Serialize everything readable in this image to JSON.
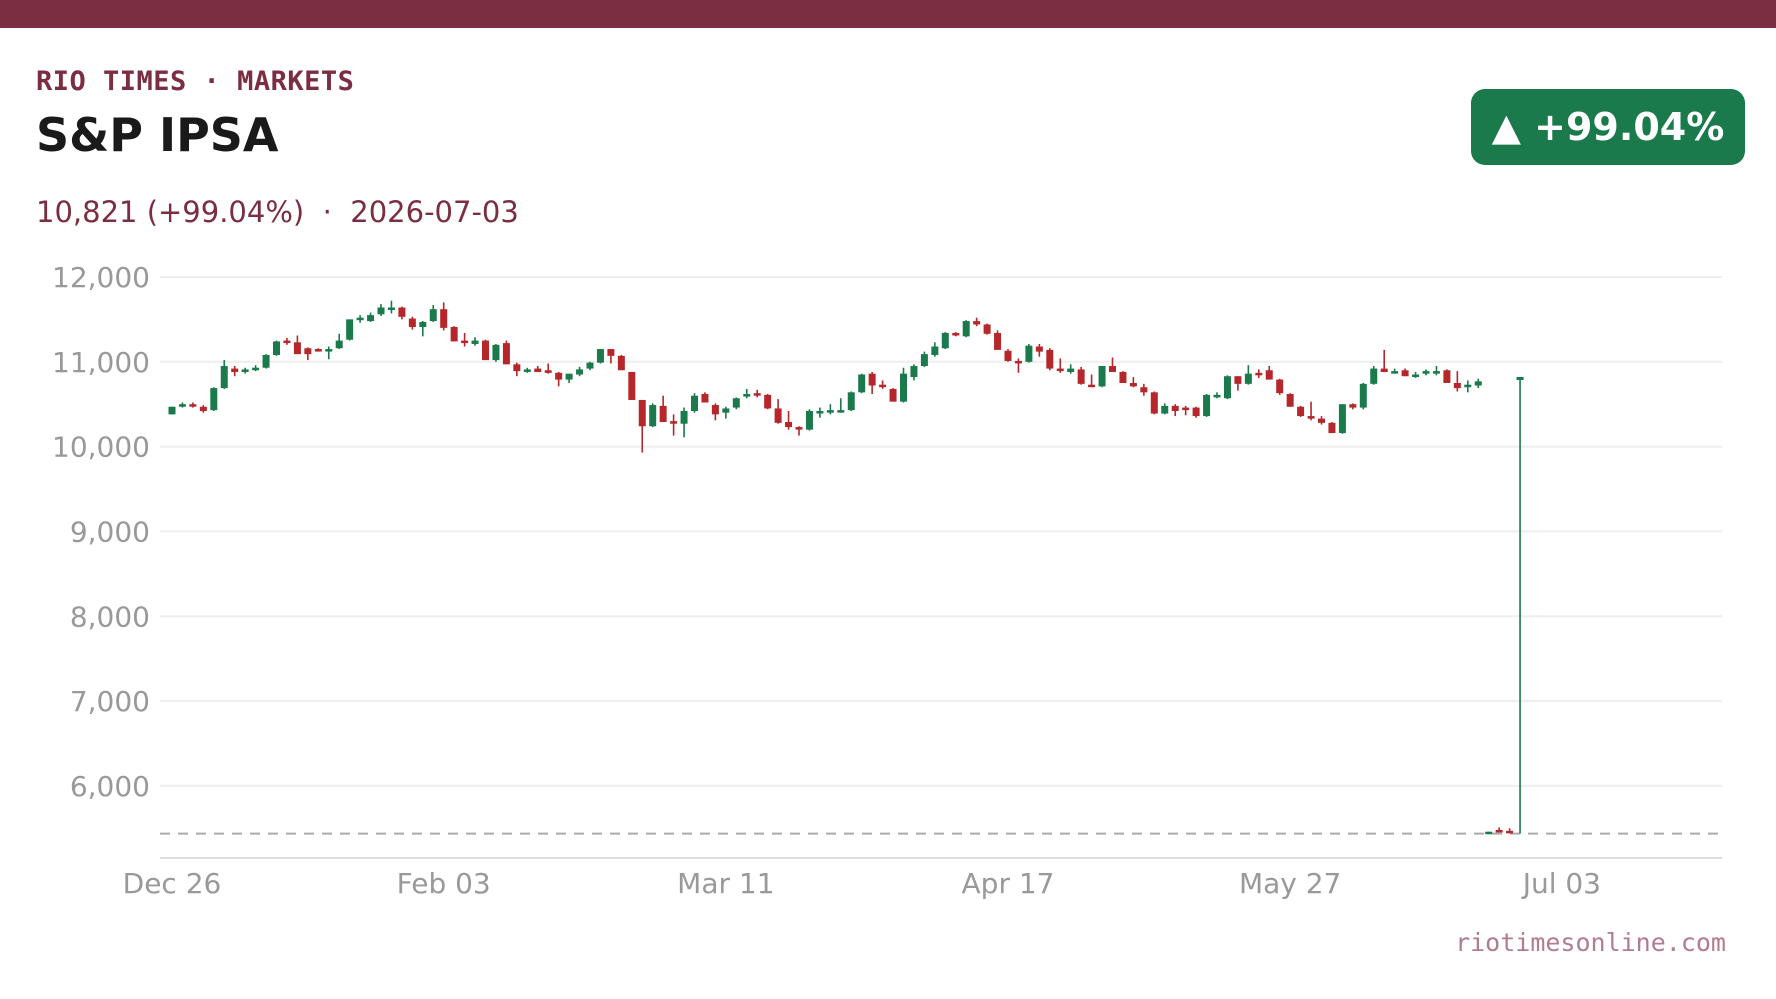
{
  "header": {
    "brand": "RIO TIMES · MARKETS",
    "title": "S&P IPSA",
    "subtitle": "10,821 (+99.04%)  ·  2026-07-03",
    "badge": "▲ +99.04%",
    "source": "riotimesonline.com"
  },
  "colors": {
    "accent": "#7b2d41",
    "up": "#1a7a4c",
    "down": "#b5272a",
    "grid": "#eeeeee",
    "axis_text": "#999999"
  },
  "chart_data": {
    "type": "candlestick",
    "title": "",
    "xlabel": "",
    "ylabel": "",
    "ylim": [
      5150,
      12200
    ],
    "yticks": [
      6000,
      7000,
      8000,
      9000,
      10000,
      11000,
      12000
    ],
    "ytick_labels": [
      "6,000",
      "7,000",
      "8,000",
      "9,000",
      "10,000",
      "11,000",
      "12,000"
    ],
    "xtick_labels": [
      "Dec 26",
      "Feb 03",
      "Mar 11",
      "Apr 17",
      "May 27",
      "Jul 03"
    ],
    "xtick_index": [
      0,
      26,
      53,
      80,
      107,
      133
    ],
    "baseline": 5437,
    "grid": true,
    "ohlc": [
      [
        10380,
        10470,
        10380,
        10470
      ],
      [
        10480,
        10520,
        10460,
        10500
      ],
      [
        10500,
        10520,
        10460,
        10480
      ],
      [
        10470,
        10490,
        10400,
        10420
      ],
      [
        10430,
        10700,
        10420,
        10690
      ],
      [
        10690,
        11020,
        10680,
        10950
      ],
      [
        10920,
        10950,
        10830,
        10880
      ],
      [
        10880,
        10930,
        10860,
        10910
      ],
      [
        10910,
        10960,
        10890,
        10930
      ],
      [
        10930,
        11090,
        10920,
        11080
      ],
      [
        11080,
        11250,
        11070,
        11240
      ],
      [
        11250,
        11280,
        11200,
        11230
      ],
      [
        11230,
        11310,
        11100,
        11090
      ],
      [
        11160,
        11170,
        11020,
        11090
      ],
      [
        11150,
        11160,
        11120,
        11140
      ],
      [
        11130,
        11180,
        11030,
        11150
      ],
      [
        11160,
        11330,
        11150,
        11250
      ],
      [
        11260,
        11500,
        11250,
        11500
      ],
      [
        11500,
        11550,
        11460,
        11520
      ],
      [
        11480,
        11580,
        11470,
        11550
      ],
      [
        11560,
        11680,
        11540,
        11640
      ],
      [
        11640,
        11720,
        11570,
        11640
      ],
      [
        11640,
        11650,
        11500,
        11530
      ],
      [
        11510,
        11530,
        11380,
        11410
      ],
      [
        11410,
        11480,
        11300,
        11470
      ],
      [
        11480,
        11670,
        11470,
        11620
      ],
      [
        11620,
        11700,
        11370,
        11400
      ],
      [
        11410,
        11420,
        11250,
        11240
      ],
      [
        11250,
        11340,
        11180,
        11220
      ],
      [
        11210,
        11290,
        11190,
        11250
      ],
      [
        11250,
        11260,
        11020,
        11020
      ],
      [
        11020,
        11210,
        11000,
        11200
      ],
      [
        11220,
        11250,
        10970,
        10970
      ],
      [
        10970,
        10990,
        10830,
        10890
      ],
      [
        10900,
        10930,
        10870,
        10910
      ],
      [
        10920,
        10950,
        10880,
        10880
      ],
      [
        10900,
        10980,
        10860,
        10870
      ],
      [
        10870,
        10880,
        10710,
        10790
      ],
      [
        10790,
        10850,
        10750,
        10860
      ],
      [
        10850,
        10940,
        10830,
        10910
      ],
      [
        10920,
        11000,
        10900,
        10990
      ],
      [
        10990,
        11150,
        10980,
        11150
      ],
      [
        11150,
        11150,
        10980,
        11070
      ],
      [
        11070,
        11080,
        10920,
        10900
      ],
      [
        10880,
        10880,
        10550,
        10550
      ],
      [
        10550,
        10550,
        9930,
        10240
      ],
      [
        10240,
        10510,
        10230,
        10490
      ],
      [
        10480,
        10600,
        10320,
        10290
      ],
      [
        10300,
        10380,
        10130,
        10270
      ],
      [
        10270,
        10460,
        10110,
        10420
      ],
      [
        10420,
        10630,
        10400,
        10600
      ],
      [
        10620,
        10640,
        10520,
        10520
      ],
      [
        10490,
        10510,
        10310,
        10380
      ],
      [
        10400,
        10470,
        10330,
        10450
      ],
      [
        10460,
        10580,
        10440,
        10570
      ],
      [
        10590,
        10680,
        10570,
        10620
      ],
      [
        10630,
        10670,
        10580,
        10620
      ],
      [
        10610,
        10620,
        10440,
        10450
      ],
      [
        10450,
        10560,
        10270,
        10280
      ],
      [
        10290,
        10420,
        10200,
        10230
      ],
      [
        10230,
        10240,
        10130,
        10200
      ],
      [
        10200,
        10440,
        10190,
        10420
      ],
      [
        10390,
        10460,
        10340,
        10420
      ],
      [
        10410,
        10500,
        10380,
        10430
      ],
      [
        10420,
        10570,
        10400,
        10430
      ],
      [
        10430,
        10650,
        10420,
        10640
      ],
      [
        10640,
        10860,
        10630,
        10850
      ],
      [
        10860,
        10880,
        10620,
        10720
      ],
      [
        10730,
        10780,
        10680,
        10710
      ],
      [
        10680,
        10690,
        10530,
        10530
      ],
      [
        10530,
        10930,
        10520,
        10860
      ],
      [
        10820,
        10970,
        10780,
        10950
      ],
      [
        10950,
        11120,
        10940,
        11090
      ],
      [
        11080,
        11230,
        11060,
        11180
      ],
      [
        11160,
        11350,
        11150,
        11340
      ],
      [
        11340,
        11350,
        11300,
        11310
      ],
      [
        11300,
        11490,
        11290,
        11480
      ],
      [
        11480,
        11520,
        11420,
        11440
      ],
      [
        11440,
        11450,
        11320,
        11330
      ],
      [
        11340,
        11370,
        11150,
        11140
      ],
      [
        11130,
        11150,
        11000,
        11010
      ],
      [
        11010,
        11040,
        10870,
        11000
      ],
      [
        11000,
        11210,
        10990,
        11190
      ],
      [
        11180,
        11210,
        11060,
        11120
      ],
      [
        11140,
        11160,
        10900,
        10920
      ],
      [
        10920,
        11040,
        10870,
        10900
      ],
      [
        10880,
        10970,
        10860,
        10920
      ],
      [
        10910,
        10940,
        10730,
        10740
      ],
      [
        10730,
        10850,
        10700,
        10720
      ],
      [
        10710,
        10950,
        10700,
        10950
      ],
      [
        10950,
        11050,
        10890,
        10880
      ],
      [
        10880,
        10890,
        10750,
        10750
      ],
      [
        10750,
        10820,
        10700,
        10710
      ],
      [
        10700,
        10740,
        10600,
        10640
      ],
      [
        10640,
        10650,
        10380,
        10390
      ],
      [
        10390,
        10510,
        10380,
        10480
      ],
      [
        10480,
        10500,
        10360,
        10420
      ],
      [
        10460,
        10480,
        10370,
        10450
      ],
      [
        10460,
        10470,
        10340,
        10360
      ],
      [
        10360,
        10620,
        10350,
        10610
      ],
      [
        10590,
        10640,
        10570,
        10610
      ],
      [
        10570,
        10840,
        10560,
        10830
      ],
      [
        10830,
        10830,
        10660,
        10740
      ],
      [
        10740,
        10960,
        10730,
        10860
      ],
      [
        10870,
        10910,
        10810,
        10850
      ],
      [
        10900,
        10950,
        10800,
        10790
      ],
      [
        10790,
        10800,
        10610,
        10630
      ],
      [
        10620,
        10630,
        10470,
        10470
      ],
      [
        10470,
        10480,
        10350,
        10360
      ],
      [
        10360,
        10530,
        10310,
        10330
      ],
      [
        10330,
        10360,
        10260,
        10280
      ],
      [
        10280,
        10290,
        10160,
        10160
      ],
      [
        10160,
        10500,
        10150,
        10500
      ],
      [
        10500,
        10510,
        10440,
        10460
      ],
      [
        10460,
        10750,
        10440,
        10740
      ],
      [
        10740,
        10950,
        10730,
        10920
      ],
      [
        10920,
        11140,
        10880,
        10880
      ],
      [
        10880,
        10920,
        10860,
        10890
      ],
      [
        10900,
        10920,
        10830,
        10830
      ],
      [
        10840,
        10880,
        10810,
        10850
      ],
      [
        10860,
        10910,
        10840,
        10890
      ],
      [
        10890,
        10950,
        10840,
        10890
      ],
      [
        10900,
        10910,
        10750,
        10750
      ],
      [
        10750,
        10890,
        10650,
        10690
      ],
      [
        10700,
        10780,
        10640,
        10730
      ],
      [
        10720,
        10800,
        10690,
        10770
      ],
      [
        5440,
        5460,
        5430,
        5460
      ],
      [
        5480,
        5510,
        5460,
        5470
      ],
      [
        5470,
        5500,
        5440,
        5460
      ],
      [
        5437,
        10821,
        5437,
        10821
      ]
    ]
  }
}
